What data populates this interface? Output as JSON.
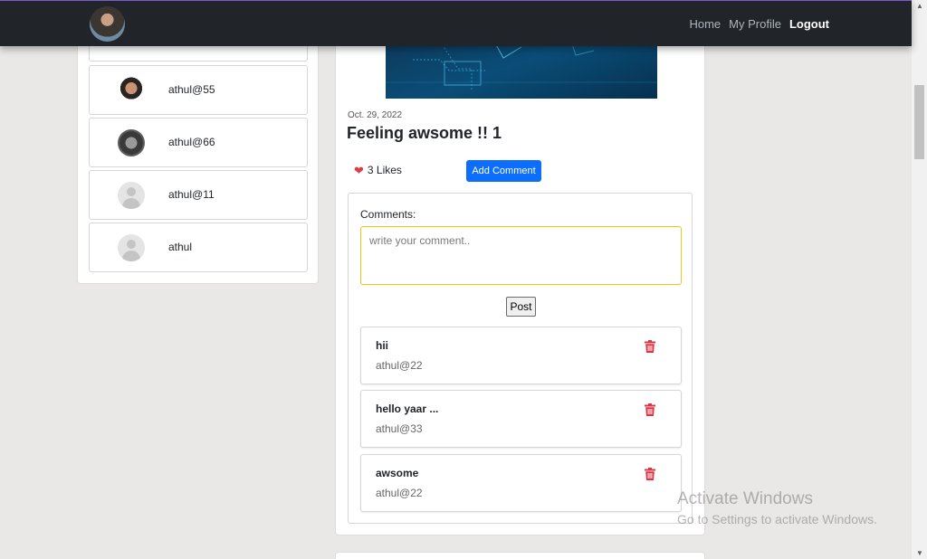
{
  "navbar": {
    "avatar_icon": "user-avatar-photo",
    "links": [
      {
        "label": "Home"
      },
      {
        "label": "My Profile"
      },
      {
        "label": "Logout"
      }
    ]
  },
  "users": [
    {
      "name": "athul@55",
      "avatar": "photo"
    },
    {
      "name": "athul@66",
      "avatar": "photo"
    },
    {
      "name": "athul@11",
      "avatar": "default-user-icon"
    },
    {
      "name": "athul",
      "avatar": "default-user-icon"
    }
  ],
  "post": {
    "date": "Oct. 29, 2022",
    "title": "Feeling awsome !! 1",
    "likes_label": "3 Likes",
    "add_comment_label": "Add Comment",
    "comments_label": "Comments:",
    "comment_placeholder": "write your comment..",
    "post_button_label": "Post",
    "comments": [
      {
        "text": "hii",
        "author": "athul@22"
      },
      {
        "text": "hello yaar ...",
        "author": "athul@33"
      },
      {
        "text": "awsome",
        "author": "athul@22"
      }
    ]
  },
  "watermark": {
    "title": "Activate Windows",
    "subtitle": "Go to Settings to activate Windows."
  },
  "colors": {
    "navbar_bg": "#212529",
    "primary_button": "#0d6efd",
    "heart": "#e03a45",
    "trash": "#dc3545",
    "input_focus_border": "#f0c419"
  }
}
